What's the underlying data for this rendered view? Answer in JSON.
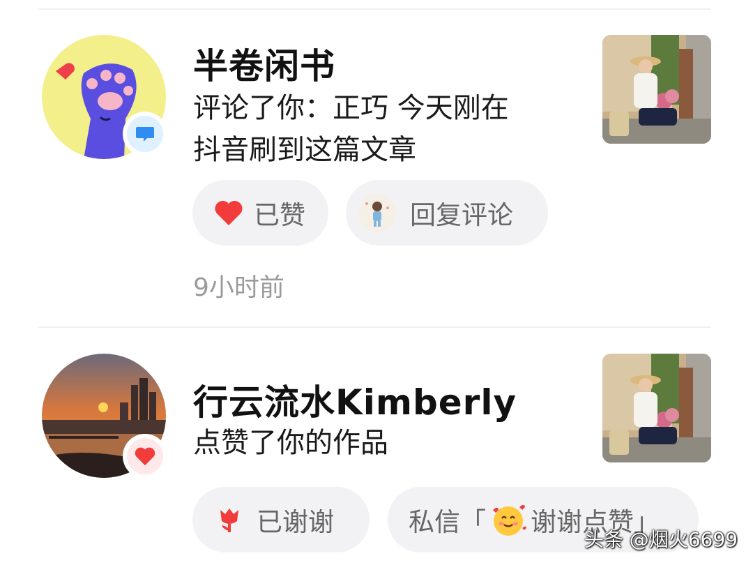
{
  "notifications": [
    {
      "username": "半卷闲书",
      "action_line1": "评论了你：正巧 今天刚在",
      "action_line2": "抖音刷到这篇文章",
      "badge_icon": "comment-bubble-icon",
      "like_label": "已赞",
      "reply_label": "回复评论",
      "time": "9小时前"
    },
    {
      "username": "行云流水Kimberly",
      "action_line1": "点赞了你的作品",
      "badge_icon": "heart-icon",
      "thank_label": "已谢谢",
      "dm_label": "私信「",
      "dm_text": "谢谢点赞」"
    }
  ],
  "watermark": "头条 @烟火6699",
  "colors": {
    "heart": "#f23b3b",
    "comment_badge": "#2f8cf0",
    "like_badge_bg": "#ffe8ea"
  }
}
